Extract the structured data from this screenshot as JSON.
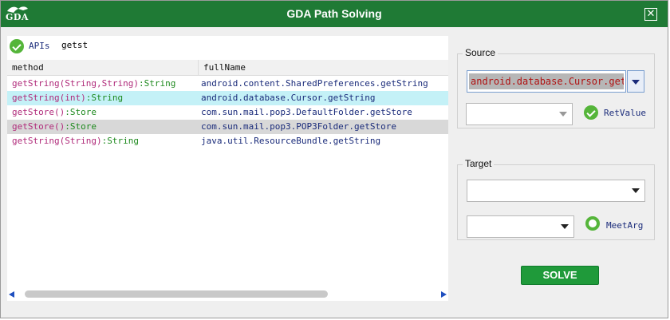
{
  "window": {
    "title": "GDA Path Solving",
    "logo_text": "GDA",
    "close_icon": "close-icon"
  },
  "colors": {
    "titlebar": "#1f7a35",
    "accent_green": "#55b53a",
    "method_name": "#b02a7a",
    "return_type": "#1f8a1f",
    "full_name": "#1a2b7a",
    "selected_cyan": "#c4f1f7",
    "selected_gray": "#d8d8d8",
    "solve_button": "#1f9a3a"
  },
  "apis": {
    "label": "APIs",
    "icon": "check-circle-icon",
    "search_value": "getst"
  },
  "table": {
    "columns": [
      "method",
      "fullName"
    ],
    "rows": [
      {
        "method_name": "getString(String,String)",
        "method_ret": ":String",
        "full_name": "android.content.SharedPreferences.getString",
        "state": "normal"
      },
      {
        "method_name": "getString(int)",
        "method_ret": ":String",
        "full_name": "android.database.Cursor.getString",
        "state": "selected-cyan"
      },
      {
        "method_name": "getStore()",
        "method_ret": ":Store",
        "full_name": "com.sun.mail.pop3.DefaultFolder.getStore",
        "state": "normal"
      },
      {
        "method_name": "getStore()",
        "method_ret": ":Store",
        "full_name": "com.sun.mail.pop3.POP3Folder.getStore",
        "state": "selected-gray"
      },
      {
        "method_name": "getString(String)",
        "method_ret": ":String",
        "full_name": "java.util.ResourceBundle.getString",
        "state": "normal"
      }
    ]
  },
  "source": {
    "label": "Source",
    "class_value": "android.database.Cursor.getString",
    "method_value": "",
    "option_label": "RetValue",
    "option_icon": "check-circle-icon"
  },
  "target": {
    "label": "Target",
    "class_value": "",
    "method_value": "",
    "option_label": "MeetArg",
    "option_icon": "ring-circle-icon"
  },
  "actions": {
    "solve_label": "SOLVE"
  }
}
